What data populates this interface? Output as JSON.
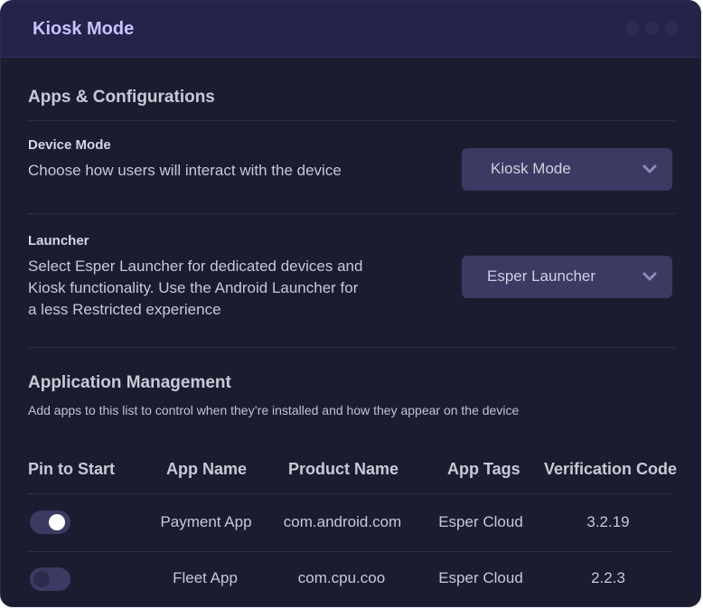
{
  "window": {
    "title": "Kiosk Mode",
    "colors": {
      "background": "#1c1c30",
      "titlebar": "#24244a",
      "accent": "#c8c2ff",
      "control": "#3b3a62"
    }
  },
  "apps_config": {
    "section_title": "Apps & Configurations",
    "device_mode": {
      "label": "Device Mode",
      "description": "Choose how users will interact with the device",
      "selected": "Kiosk Mode",
      "icon": "chevron-down-icon"
    },
    "launcher": {
      "label": "Launcher",
      "description_lines": [
        "Select Esper Launcher for dedicated devices and",
        "Kiosk functionality. Use the Android Launcher for",
        "a less Restricted experience"
      ],
      "selected": "Esper Launcher",
      "icon": "chevron-down-icon"
    }
  },
  "app_management": {
    "section_title": "Application Management",
    "description": "Add apps to this list to control when they’re installed and how they appear on the device",
    "columns": [
      "Pin to Start",
      "App Name",
      "Product Name",
      "App Tags",
      "Verification Code"
    ],
    "rows": [
      {
        "pinned": true,
        "app_name": "Payment App",
        "product_name": "com.android.com",
        "app_tags": "Esper Cloud",
        "verification_code": "3.2.19"
      },
      {
        "pinned": false,
        "app_name": "Fleet App",
        "product_name": "com.cpu.coo",
        "app_tags": "Esper Cloud",
        "verification_code": "2.2.3"
      }
    ]
  }
}
